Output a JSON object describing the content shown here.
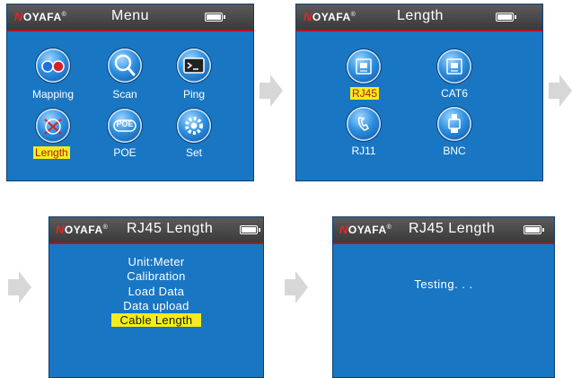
{
  "brand": {
    "logo_n": "N",
    "logo_rest": "OYAFA",
    "reg": "®"
  },
  "screens": {
    "menu": {
      "title": "Menu",
      "items": [
        {
          "label": "Mapping",
          "icon": "mapping-icon"
        },
        {
          "label": "Scan",
          "icon": "magnifier-icon"
        },
        {
          "label": "Ping",
          "icon": "terminal-icon"
        },
        {
          "label": "Length",
          "icon": "length-icon",
          "selected": true
        },
        {
          "label": "POE",
          "icon": "poe-icon"
        },
        {
          "label": "Set",
          "icon": "gear-icon"
        }
      ]
    },
    "length": {
      "title": "Length",
      "items": [
        {
          "label": "RJ45",
          "icon": "rj45-icon",
          "selected": true
        },
        {
          "label": "CAT6",
          "icon": "cat6-icon"
        },
        {
          "label": "RJ11",
          "icon": "phone-icon"
        },
        {
          "label": "BNC",
          "icon": "bnc-icon"
        }
      ]
    },
    "rj45_length": {
      "title": "RJ45 Length",
      "items": [
        "Unit:Meter",
        "Calibration",
        "Load Data",
        "Data upload",
        "Cable Length"
      ],
      "selected_item": "Cable Length"
    },
    "testing": {
      "title": "RJ45 Length",
      "status": "Testing. . ."
    }
  },
  "colors": {
    "screen_bg": "#1976c3",
    "header_bg": "#474747",
    "highlight": "#f7ec19",
    "accent_red": "#b1161c",
    "arrow": "#d7d7d7"
  },
  "poe_icon_text": "POE"
}
